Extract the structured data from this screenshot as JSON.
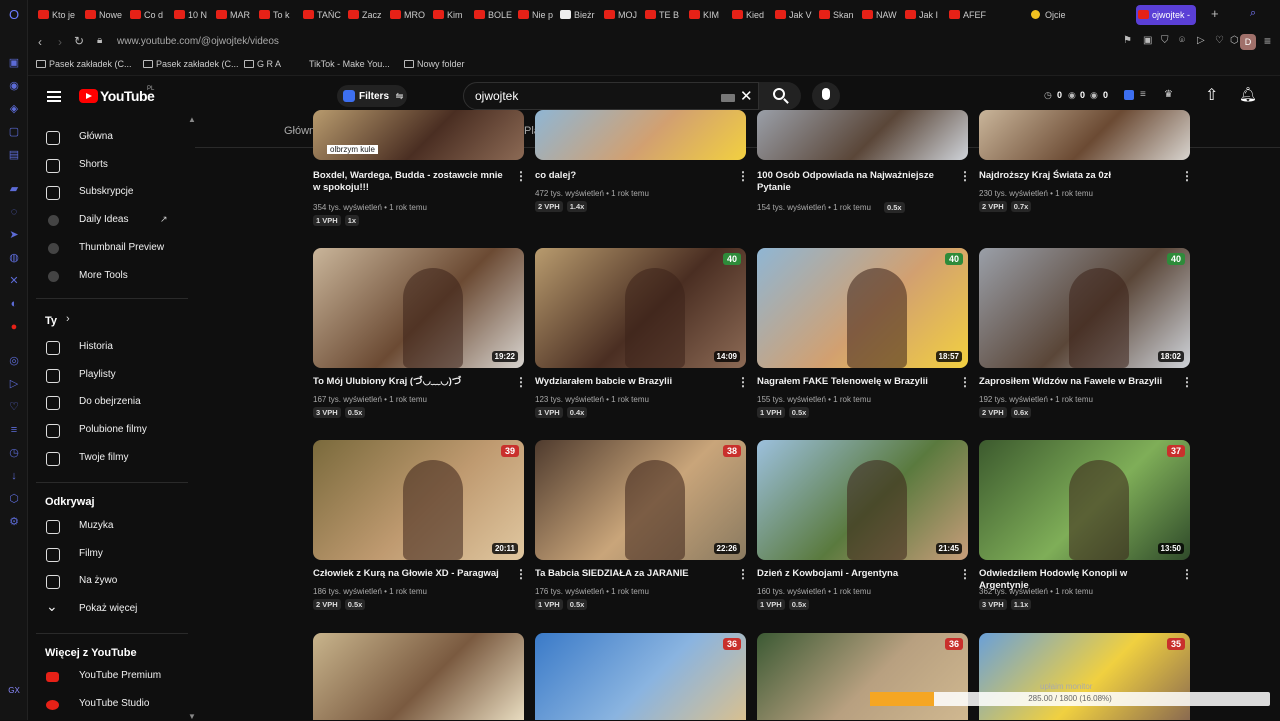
{
  "browser": {
    "tabs": [
      {
        "label": "Kto je"
      },
      {
        "label": "Nowe"
      },
      {
        "label": "Co d"
      },
      {
        "label": "10 N"
      },
      {
        "label": "MAR"
      },
      {
        "label": "To k"
      },
      {
        "label": "TAŃC"
      },
      {
        "label": "Zacz"
      },
      {
        "label": "MRO"
      },
      {
        "label": "Kim"
      },
      {
        "label": "BOLE"
      },
      {
        "label": "Nie p"
      },
      {
        "label": "Bieżr"
      },
      {
        "label": "MOJ"
      },
      {
        "label": "TE B"
      },
      {
        "label": "KIM"
      },
      {
        "label": "Kied"
      },
      {
        "label": "Jak V"
      },
      {
        "label": "Skan"
      },
      {
        "label": "NAW"
      },
      {
        "label": "Jak I"
      },
      {
        "label": "AFEF"
      },
      {
        "label": "Ojcie"
      }
    ],
    "active_tab": "ojwojtek -",
    "url": "www.youtube.com/@ojwojtek/videos",
    "bookmarks": [
      {
        "label": "Pasek zakładek (C..."
      },
      {
        "label": "Pasek zakładek (C..."
      },
      {
        "label": "G R A"
      },
      {
        "label": "TikTok - Make You..."
      },
      {
        "label": "Nowy folder"
      }
    ],
    "profile_initial": "D"
  },
  "header": {
    "logo_text": "YouTube",
    "logo_region": "PL",
    "filters_label": "Filters",
    "search_value": "ojwojtek",
    "counters": [
      "0",
      "0",
      "0"
    ]
  },
  "channel_tabs": [
    "Główna",
    "Wideo",
    "Shorts",
    "Na żywo",
    "Playlisty",
    "Posty"
  ],
  "active_channel_tab": "Wideo",
  "leftnav": {
    "main": [
      {
        "label": "Główna",
        "icon": "home-icon"
      },
      {
        "label": "Shorts",
        "icon": "shorts-icon"
      },
      {
        "label": "Subskrypcje",
        "icon": "subscriptions-icon"
      },
      {
        "label": "Daily Ideas",
        "icon": "extension-icon"
      },
      {
        "label": "Thumbnail Preview",
        "icon": "extension-icon"
      },
      {
        "label": "More Tools",
        "icon": "extension-icon"
      }
    ],
    "you_label": "Ty",
    "you": [
      {
        "label": "Historia",
        "icon": "history-icon"
      },
      {
        "label": "Playlisty",
        "icon": "playlist-icon"
      },
      {
        "label": "Do obejrzenia",
        "icon": "clock-icon"
      },
      {
        "label": "Polubione filmy",
        "icon": "thumb-up-icon"
      },
      {
        "label": "Twoje filmy",
        "icon": "video-icon"
      }
    ],
    "explore_label": "Odkrywaj",
    "explore": [
      {
        "label": "Muzyka",
        "icon": "music-icon"
      },
      {
        "label": "Filmy",
        "icon": "film-icon"
      },
      {
        "label": "Na żywo",
        "icon": "live-icon"
      },
      {
        "label": "Pokaż więcej",
        "icon": "chevron-down-icon"
      }
    ],
    "more_label": "Więcej z YouTube",
    "more": [
      {
        "label": "YouTube Premium",
        "icon": "yt-premium-icon"
      },
      {
        "label": "YouTube Studio",
        "icon": "yt-studio-icon"
      }
    ]
  },
  "videos": {
    "row0": [
      {
        "title": "Boxdel, Wardega, Budda - zostawcie mnie w spokoju!!!",
        "meta": "354 tys. wyświetleń • 1 rok temu",
        "stats": [
          "1 VPH",
          "1x"
        ],
        "thumb_text": "olbrzym kule"
      },
      {
        "title": "co dalej?",
        "meta": "472 tys. wyświetleń • 1 rok temu",
        "stats": [
          "2 VPH",
          "1.4x"
        ]
      },
      {
        "title": "100 Osób Odpowiada na Najważniejsze Pytanie",
        "meta": "154 tys. wyświetleń • 1 rok temu",
        "stats": [
          "0.5x"
        ]
      },
      {
        "title": "Najdroższy Kraj Świata za 0zł",
        "meta": "230 tys. wyświetleń • 1 rok temu",
        "stats": [
          "2 VPH",
          "0.7x"
        ]
      }
    ],
    "row1": [
      {
        "title": "To Mój Ulubiony Kraj (づ◡﹏◡)づ",
        "meta": "167 tys. wyświetleń • 1 rok temu",
        "stats": [
          "3 VPH",
          "0.5x"
        ],
        "duration": "19:22",
        "badge": ""
      },
      {
        "title": "Wydziarałem babcie w Brazylii",
        "meta": "123 tys. wyświetleń • 1 rok temu",
        "stats": [
          "1 VPH",
          "0.4x"
        ],
        "duration": "14:09",
        "badge": "40"
      },
      {
        "title": "Nagrałem FAKE Telenowelę w Brazylii",
        "meta": "155 tys. wyświetleń • 1 rok temu",
        "stats": [
          "1 VPH",
          "0.5x"
        ],
        "duration": "18:57",
        "badge": "40"
      },
      {
        "title": "Zaprosiłem Widzów na Fawele w Brazylii",
        "meta": "192 tys. wyświetleń • 1 rok temu",
        "stats": [
          "2 VPH",
          "0.6x"
        ],
        "duration": "18:02",
        "badge": "40"
      }
    ],
    "row2": [
      {
        "title": "Człowiek z Kurą na Głowie XD - Paragwaj",
        "meta": "186 tys. wyświetleń • 1 rok temu",
        "stats": [
          "2 VPH",
          "0.5x"
        ],
        "duration": "20:11",
        "badge": "39"
      },
      {
        "title": "Ta Babcia SIEDZIAŁA za JARANIE",
        "meta": "176 tys. wyświetleń • 1 rok temu",
        "stats": [
          "1 VPH",
          "0.5x"
        ],
        "duration": "22:26",
        "badge": "38"
      },
      {
        "title": "Dzień z Kowbojami - Argentyna",
        "meta": "160 tys. wyświetleń • 1 rok temu",
        "stats": [
          "1 VPH",
          "0.5x"
        ],
        "duration": "21:45",
        "badge": ""
      },
      {
        "title": "Odwiedziłem Hodowlę Konopii w Argentynie",
        "meta": "362 tys. wyświetleń • 1 rok temu",
        "stats": [
          "3 VPH",
          "1.1x"
        ],
        "duration": "13:50",
        "badge": "37"
      }
    ],
    "row3": [
      {
        "badge": ""
      },
      {
        "badge": "36"
      },
      {
        "badge": "36"
      },
      {
        "badge": "35"
      }
    ]
  },
  "progress": {
    "title": "upłaim monitor",
    "label": "285.00 / 1800 (16.08%)",
    "fraction": 0.16
  }
}
